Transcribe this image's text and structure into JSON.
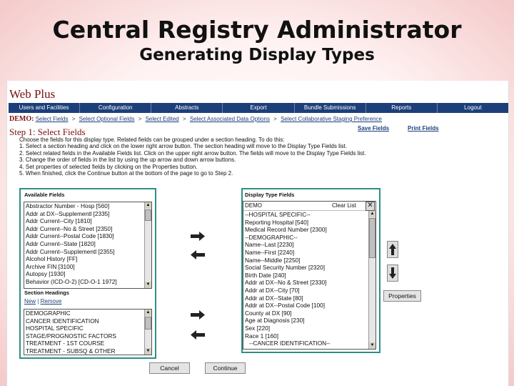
{
  "slide": {
    "title": "Central Registry Administrator",
    "subtitle": "Generating Display Types"
  },
  "app": {
    "title": "Web Plus"
  },
  "nav": {
    "items": [
      "Users and Facilities",
      "Configuration",
      "Abstracts",
      "Export",
      "Bundle Submissions",
      "Reports",
      "Logout"
    ]
  },
  "breadcrumb": {
    "label": "DEMO:",
    "items": [
      "Select Fields",
      "Select Optional Fields",
      "Select Edited",
      "Select Associated Data Options",
      "Select Collaborative Staging Preference"
    ]
  },
  "step": {
    "title": "Step 1: Select Fields",
    "save_fields": "Save Fields",
    "print_fields": "Print Fields"
  },
  "instructions": [
    "Choose the fields for this display type. Related fields can be grouped under a section heading. To do this:",
    "1. Select a section heading and click on the lower right arrow button. The section heading will move to the Display Type Fields list.",
    "2. Select related fields in the Available Fields list. Click on the upper right arrow button. The fields will move to the Display Type Fields list.",
    "3. Change the order of fields in the list by using the up arrow and down arrow buttons.",
    "4. Set properties of selected fields by clicking on the Properties button.",
    "5. When finished, click the Continue button at the bottom of the page to go to Step 2."
  ],
  "available": {
    "title": "Available Fields",
    "items": [
      "Abstractor Number - Hosp [560]",
      "Addr at DX--Supplementl [2335]",
      "Addr Current--City [1810]",
      "Addr Current--No & Street [2350]",
      "Addr Current--Postal Code [1830]",
      "Addr Current--State [1820]",
      "Addr Current--Supplementl [2355]",
      "Alcohol History [FF]",
      "Archive FIN [3100]",
      "Autopsy [1930]",
      "Behavior (ICD-O-2) [CD-O-1 1972]"
    ],
    "section_title": "Section Headings",
    "new_label": "New",
    "remove_label": "Remove",
    "sections": [
      "DEMOGRAPHIC",
      "CANCER IDENTIFICATION",
      "HOSPITAL SPECIFIC",
      "STAGE/PROGNOSTIC FACTORS",
      "TREATMENT - 1ST COURSE",
      "TREATMENT - SUBSQ & OTHER"
    ]
  },
  "display": {
    "title": "Display Type Fields",
    "header_value": "DEMO",
    "clear_label": "Clear List",
    "items": [
      "--HOSPITAL SPECIFIC--",
      "Reporting Hospital [540]",
      "Medical Record Number [2300]",
      "--DEMOGRAPHIC--",
      "Name--Last [2230]",
      "Name--First [2240]",
      "Name--Middle [2250]",
      "Social Security Number [2320]",
      "Birth Date [240]",
      "Addr at DX--No & Street [2330]",
      "Addr at DX--City [70]",
      "Addr at DX--State [80]",
      "Addr at DX--Postal Code [100]",
      "County at DX [90]",
      "Age at Diagnosis [230]",
      "Sex [220]",
      "Race 1 [160]",
      "--CANCER IDENTIFICATION--"
    ]
  },
  "buttons": {
    "properties": "Properties",
    "cancel": "Cancel",
    "continue": "Continue"
  }
}
